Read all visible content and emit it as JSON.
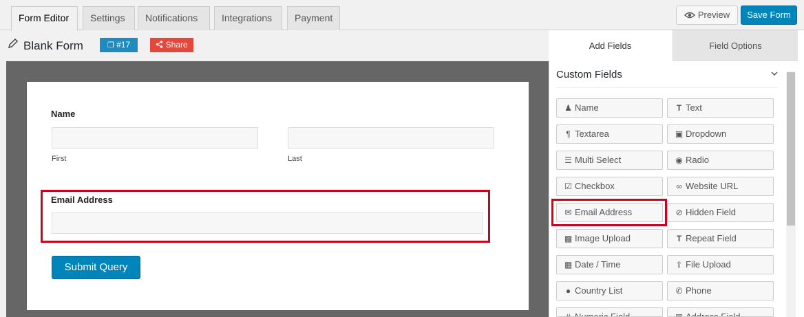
{
  "tabs": [
    "Form Editor",
    "Settings",
    "Notifications",
    "Integrations",
    "Payment"
  ],
  "header": {
    "preview_label": "Preview",
    "save_label": "Save Form",
    "form_title": "Blank Form",
    "form_id": "#17",
    "share_label": "Share"
  },
  "form": {
    "name_label": "Name",
    "first_label": "First",
    "last_label": "Last",
    "email_label": "Email Address",
    "submit_label": "Submit Query"
  },
  "panel": {
    "tab_add_fields": "Add Fields",
    "tab_field_options": "Field Options",
    "section_title": "Custom Fields",
    "fields": [
      {
        "label": "Name",
        "icon": "user-icon"
      },
      {
        "label": "Text",
        "icon": "text-icon"
      },
      {
        "label": "Textarea",
        "icon": "paragraph-icon"
      },
      {
        "label": "Dropdown",
        "icon": "caret-square-icon"
      },
      {
        "label": "Multi Select",
        "icon": "list-icon"
      },
      {
        "label": "Radio",
        "icon": "dot-circle-icon"
      },
      {
        "label": "Checkbox",
        "icon": "check-square-icon"
      },
      {
        "label": "Website URL",
        "icon": "link-icon"
      },
      {
        "label": "Email Address",
        "icon": "envelope-icon"
      },
      {
        "label": "Hidden Field",
        "icon": "eye-slash-icon"
      },
      {
        "label": "Image Upload",
        "icon": "image-icon"
      },
      {
        "label": "Repeat Field",
        "icon": "text-icon"
      },
      {
        "label": "Date / Time",
        "icon": "calendar-icon"
      },
      {
        "label": "File Upload",
        "icon": "upload-icon"
      },
      {
        "label": "Country List",
        "icon": "globe-icon"
      },
      {
        "label": "Phone",
        "icon": "phone-icon"
      },
      {
        "label": "Numeric Field",
        "icon": "hash-icon"
      },
      {
        "label": "Address Field",
        "icon": "address-card-icon"
      }
    ]
  },
  "colors": {
    "primary": "#0085ba",
    "share": "#e5473a",
    "highlight": "#d0021b"
  }
}
